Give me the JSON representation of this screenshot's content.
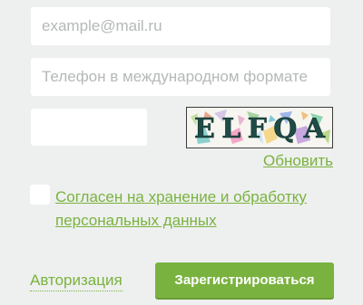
{
  "form": {
    "email_placeholder": "example@mail.ru",
    "phone_placeholder": "Телефон в международном формате",
    "captcha_text": "ELFQA",
    "refresh_label": "Обновить",
    "consent_line1": "Согласен на хранение и обработку",
    "consent_line2": "персональных данных",
    "consent_checked": false,
    "auth_link": "Авторизация",
    "register_button": "Зарегистрироваться"
  },
  "colors": {
    "accent": "#7ab23f",
    "background": "#eef0ef",
    "field": "#ffffff",
    "placeholder": "#b4b9b6"
  }
}
